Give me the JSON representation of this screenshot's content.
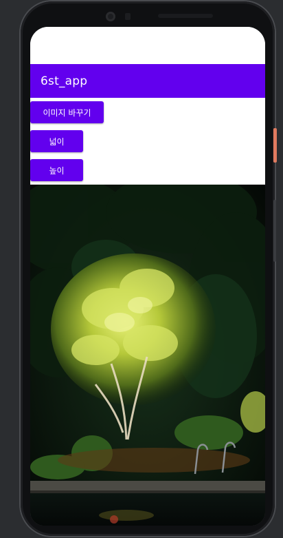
{
  "app": {
    "title": "6st_app"
  },
  "buttons": {
    "change_image": "이미지 바꾸기",
    "width": "넓이",
    "height": "높이"
  },
  "image": {
    "subject": "illuminated-tree-at-night"
  },
  "colors": {
    "primary": "#6200ee",
    "on_primary": "#ffffff",
    "background": "#ffffff",
    "device_frame": "#0f1012",
    "emulator_bg": "#2b2d30"
  },
  "icons": [
    "front-camera-icon",
    "sensor-icon",
    "speaker-grille-icon"
  ]
}
